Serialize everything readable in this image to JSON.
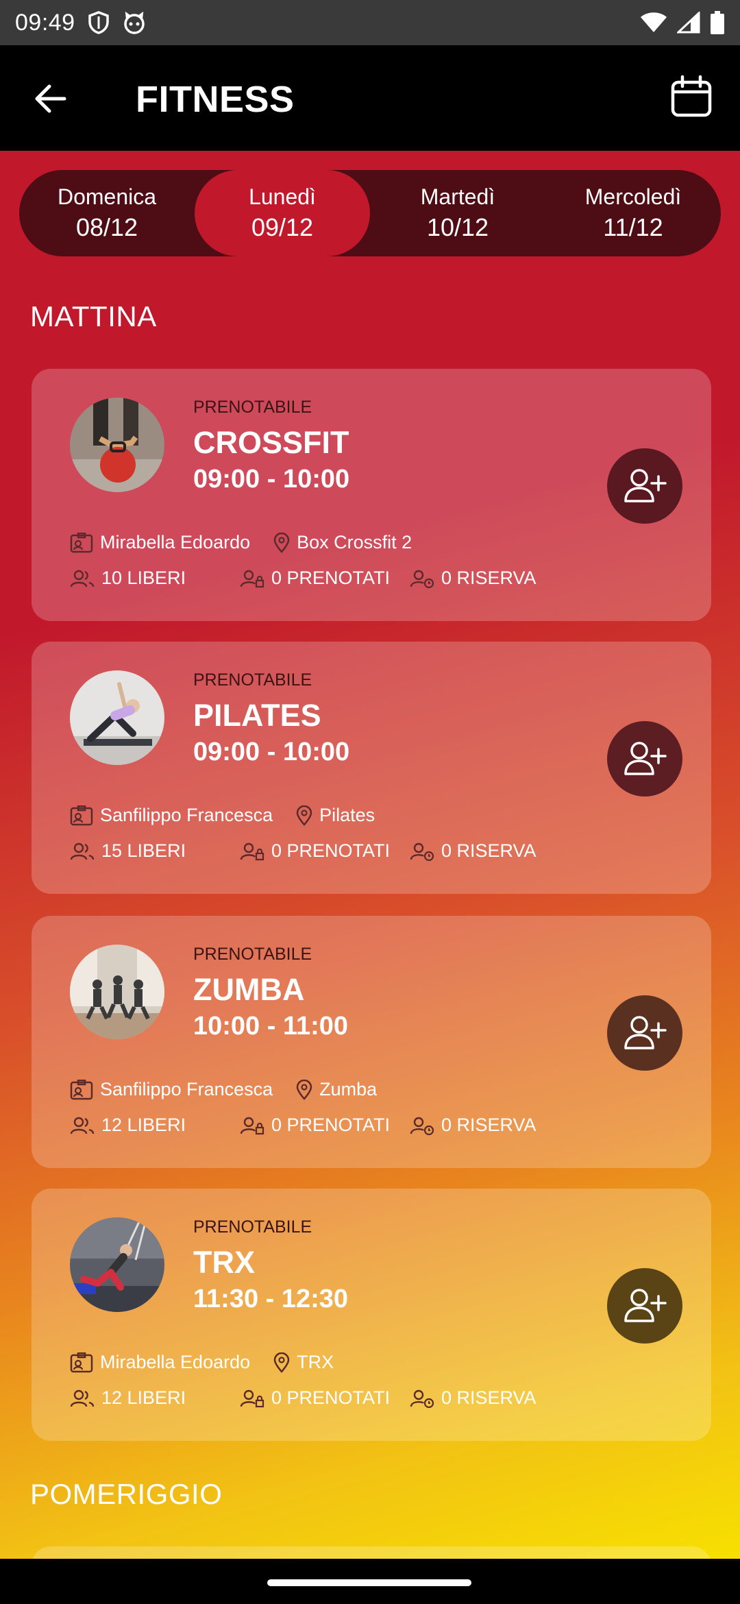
{
  "status_bar": {
    "time": "09:49",
    "icons": [
      "shield-icon",
      "cat-icon",
      "wifi-icon",
      "signal-icon",
      "battery-icon"
    ]
  },
  "app_bar": {
    "title": "FITNESS",
    "back_icon": "arrow-left-icon",
    "calendar_icon": "calendar-icon"
  },
  "days": [
    {
      "name": "Domenica",
      "date": "08/12",
      "active": false
    },
    {
      "name": "Lunedì",
      "date": "09/12",
      "active": true
    },
    {
      "name": "Martedì",
      "date": "10/12",
      "active": false
    },
    {
      "name": "Mercoledì",
      "date": "11/12",
      "active": false
    }
  ],
  "sections": {
    "morning": "MATTINA",
    "afternoon": "POMERIGGIO"
  },
  "classes": [
    {
      "status": "PRENOTABILE",
      "title": "CROSSFIT",
      "time": "09:00 - 10:00",
      "instructor": "Mirabella Edoardo",
      "location": "Box Crossfit 2",
      "free": "10 LIBERI",
      "booked": "0 PRENOTATI",
      "reserve": "0 RISERVA",
      "button_color": "#5a1820"
    },
    {
      "status": "PRENOTABILE",
      "title": "PILATES",
      "time": "09:00 - 10:00",
      "instructor": "Sanfilippo Francesca",
      "location": "Pilates",
      "free": "15 LIBERI",
      "booked": "0 PRENOTATI",
      "reserve": "0 RISERVA",
      "button_color": "#5c1e22"
    },
    {
      "status": "PRENOTABILE",
      "title": "ZUMBA",
      "time": "10:00 - 11:00",
      "instructor": "Sanfilippo Francesca",
      "location": "Zumba",
      "free": "12 LIBERI",
      "booked": "0 PRENOTATI",
      "reserve": "0 RISERVA",
      "button_color": "#5a3020"
    },
    {
      "status": "PRENOTABILE",
      "title": "TRX",
      "time": "11:30 - 12:30",
      "instructor": "Mirabella Edoardo",
      "location": "TRX",
      "free": "12 LIBERI",
      "booked": "0 PRENOTATI",
      "reserve": "0 RISERVA",
      "button_color": "#5a4416"
    }
  ]
}
